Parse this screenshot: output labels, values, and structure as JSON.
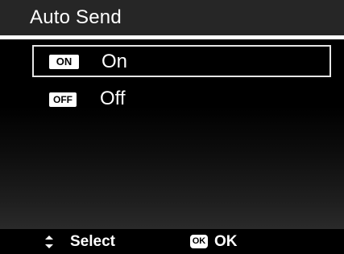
{
  "screen": {
    "title": "Auto Send"
  },
  "options": [
    {
      "badge": "ON",
      "label": "On",
      "selected": true
    },
    {
      "badge": "OFF",
      "label": "Off",
      "selected": false
    }
  ],
  "footer": {
    "select_label": "Select",
    "ok_badge": "OK",
    "ok_label": "OK",
    "nav_icon": "up-down-arrows-icon",
    "ok_icon": "ok-button-icon"
  },
  "colors": {
    "background": "#000000",
    "title_bar": "#262626",
    "separator": "#ffffff",
    "highlight_border": "#e6e6e6",
    "text": "#ffffff"
  }
}
